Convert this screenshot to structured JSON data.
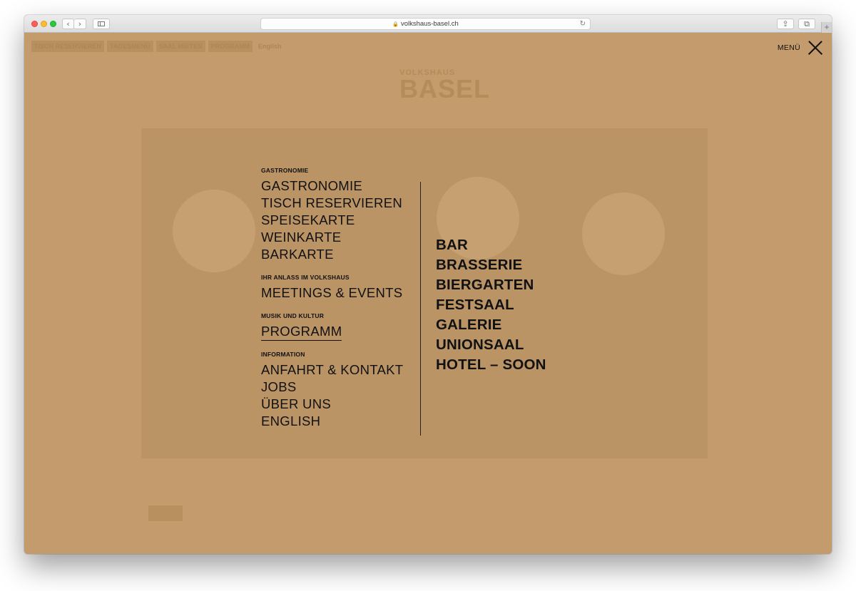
{
  "browser": {
    "url": "volkshaus-basel.ch"
  },
  "background": {
    "nav_items": [
      "TISCH RESERVIEREN",
      "TAGESMENÜ",
      "SAAL MIETEN",
      "PROGRAMM",
      "English"
    ],
    "logo_top": "VOLKSHAUS",
    "logo_main": "BASEL"
  },
  "menu_toggle": {
    "label": "MENÜ"
  },
  "menu": {
    "groups": [
      {
        "title": "GASTRONOMIE",
        "items": [
          "GASTRONOMIE",
          "TISCH RESERVIEREN",
          "SPEISEKARTE",
          "WEINKARTE",
          "BARKARTE"
        ]
      },
      {
        "title": "IHR ANLASS IM VOLKSHAUS",
        "items": [
          "MEETINGS & EVENTS"
        ]
      },
      {
        "title": "MUSIK UND KULTUR",
        "items": [
          "PROGRAMM"
        ]
      },
      {
        "title": "INFORMATION",
        "items": [
          "ANFAHRT & KONTAKT",
          "JOBS",
          "ÜBER UNS",
          "ENGLISH"
        ]
      }
    ]
  },
  "venues": [
    "BAR",
    "BRASSERIE",
    "BIERGARTEN",
    "FESTSAAL",
    "GALERIE",
    "UNIONSAAL",
    "HOTEL – SOON"
  ],
  "colors": {
    "overlay": "#c39b6c",
    "text": "#111111"
  }
}
